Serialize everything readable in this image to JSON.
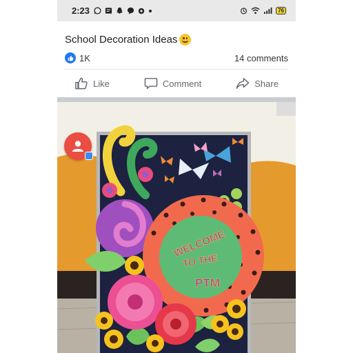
{
  "status_bar": {
    "time": "2:23",
    "battery": "76",
    "notif_icons": [
      "whatsapp-icon",
      "message-icon",
      "snapchat-icon",
      "messenger-icon",
      "app-icon",
      "dot-icon"
    ],
    "system_icons": [
      "alarm-icon",
      "wifi-icon",
      "signal-icon",
      "battery-icon"
    ]
  },
  "post": {
    "title": "School Decoration Ideas",
    "emoji": "smiling-face-emoji",
    "likes": "1K",
    "comments": "14 comments"
  },
  "actions": {
    "like": "Like",
    "comment": "Comment",
    "share": "Share"
  },
  "photo": {
    "sign_lines": [
      "WELCOME",
      "TO THE",
      "PTM"
    ]
  },
  "colors": {
    "like_blue": "#2078f4",
    "status_bg": "#e9e9e9",
    "avatar_red": "#ea4d42"
  }
}
